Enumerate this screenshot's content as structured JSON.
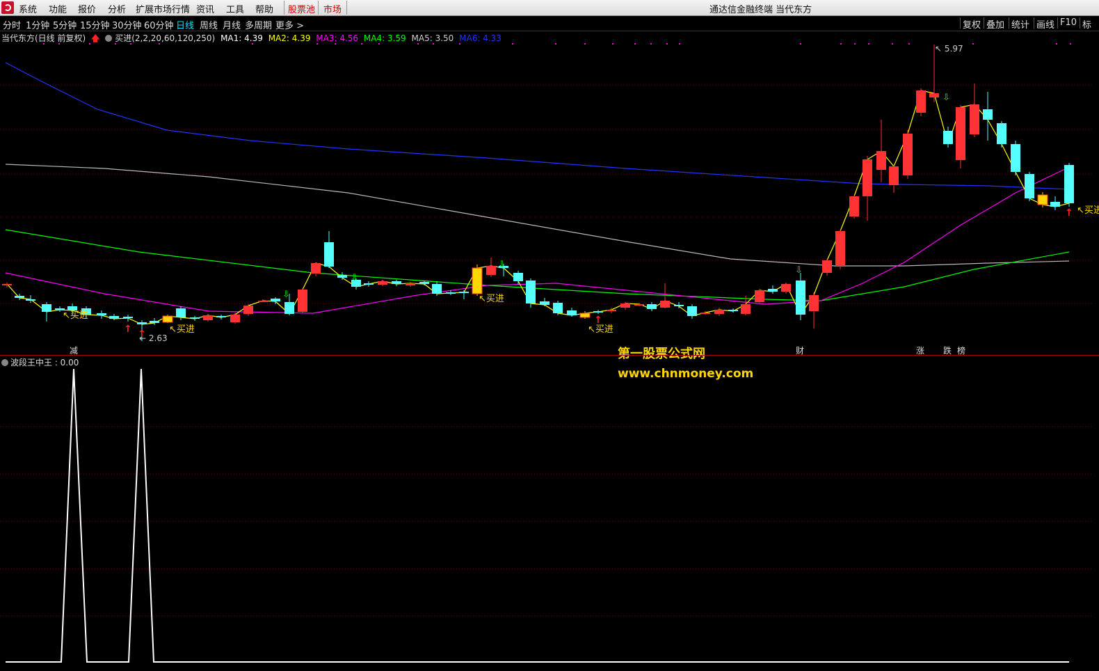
{
  "menubar": {
    "items": [
      "系统",
      "功能",
      "报价",
      "分析",
      "扩展市场行情",
      "资讯",
      "工具",
      "帮助",
      "股票池",
      "市场"
    ],
    "title": "通达信金融终端  当代东方"
  },
  "periodbar": {
    "periods": [
      "分时",
      "1分钟",
      "5分钟",
      "15分钟",
      "30分钟",
      "60分钟",
      "日线",
      "周线",
      "月线",
      "多周期",
      "更多 >"
    ],
    "active_index": 6,
    "tools": [
      "复权",
      "叠加",
      "统计",
      "画线",
      "F10",
      "标"
    ]
  },
  "legend": {
    "stock": "当代东方(日线 前复权)",
    "formula": "买进(2,2,20,60,120,250)",
    "ma": [
      {
        "label": "MA1: 4.39",
        "color": "#ffffff"
      },
      {
        "label": "MA2: 4.39",
        "color": "#ffff00"
      },
      {
        "label": "MA3: 4.56",
        "color": "#ff00ff"
      },
      {
        "label": "MA4: 3.59",
        "color": "#00ff00"
      },
      {
        "label": "MA5: 3.50",
        "color": "#cccccc"
      },
      {
        "label": "MA6: 4.33",
        "color": "#2233ff"
      }
    ]
  },
  "main_chart": {
    "high_label": "5.97",
    "low_label": "2.63",
    "buy_label": "买进",
    "event_flags": [
      {
        "text": "减",
        "color": "#00ff00"
      },
      {
        "text": "财",
        "color": "#4488ff"
      },
      {
        "text": "涨",
        "color": "#ff4444"
      },
      {
        "text": "跌",
        "color": "#00ff00"
      },
      {
        "text": "榜",
        "color": "#ff9900"
      }
    ]
  },
  "indicator": {
    "label": "波段王中王 : 0.00"
  },
  "watermark": {
    "line1": "第一股票公式网",
    "line2": "www.chnmoney.com"
  },
  "colors": {
    "up": "#ff3333",
    "down": "#55ffff",
    "signal": "#ffd700",
    "grid": "#7a0000"
  }
}
